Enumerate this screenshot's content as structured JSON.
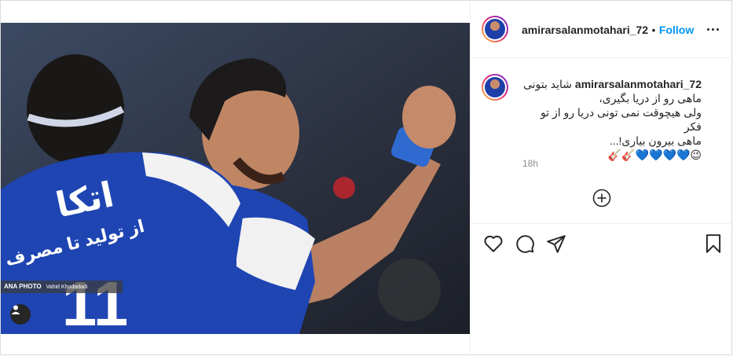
{
  "header": {
    "username": "amirarsalanmotahari_72",
    "separator": "•",
    "follow_label": "Follow",
    "more_icon": "more-horizontal-icon"
  },
  "media": {
    "credit_brand": "ANA PHOTO",
    "credit_name": "Vahid Khodadadi",
    "jersey_text": "اتکا",
    "jersey_sub": "از تولید تا مصرف با",
    "tag_icon": "user-tag-icon"
  },
  "caption": {
    "username": "amirarsalanmotahari_72",
    "text": "شاید بتونی\nماهی رو از دریا بگیری،\nولی هیچوقت نمی تونی دریا رو از تو فکر\nماهی بیرون بیاری!...\n😉💙💙💙💙🎸🎸",
    "time": "18h"
  },
  "load_more_icon": "plus-circle-icon",
  "actions": [
    "heart-icon",
    "comment-icon",
    "share-icon",
    "bookmark-icon"
  ],
  "colors": {
    "accent": "#0095f6",
    "jersey": "#1f45b3",
    "text": "#262626",
    "muted": "#8e8e8e"
  }
}
